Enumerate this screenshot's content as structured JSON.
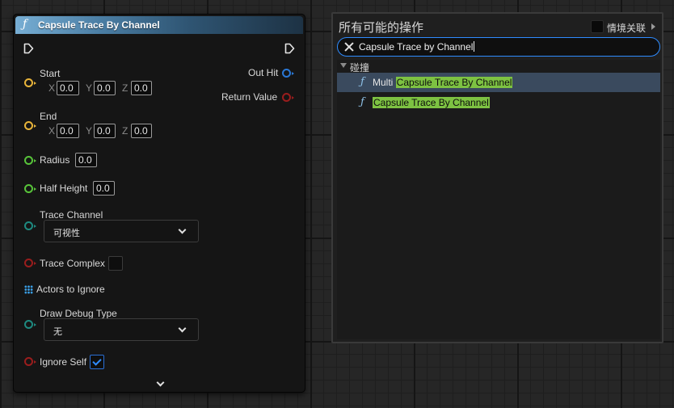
{
  "node": {
    "title": "Capsule Trace By Channel",
    "inputs": {
      "start": {
        "label": "Start",
        "x": "0.0",
        "y": "0.0",
        "z": "0.0"
      },
      "end": {
        "label": "End",
        "x": "0.0",
        "y": "0.0",
        "z": "0.0"
      },
      "radius": {
        "label": "Radius",
        "value": "0.0"
      },
      "half_height": {
        "label": "Half Height",
        "value": "0.0"
      },
      "trace_channel": {
        "label": "Trace Channel",
        "value": "可视性"
      },
      "trace_complex": {
        "label": "Trace Complex",
        "checked": false
      },
      "actors_to_ignore": {
        "label": "Actors to Ignore"
      },
      "draw_debug_type": {
        "label": "Draw Debug Type",
        "value": "无"
      },
      "ignore_self": {
        "label": "Ignore Self",
        "checked": true
      }
    },
    "axis_labels": {
      "x": "X",
      "y": "Y",
      "z": "Z"
    },
    "outputs": {
      "out_hit": "Out Hit",
      "return_value": "Return Value"
    }
  },
  "action_menu": {
    "title": "所有可能的操作",
    "context_label": "情境关联",
    "search_value": "Capsule Trace by Channel",
    "category": "碰撞",
    "results": [
      {
        "prefix": "Multi ",
        "match": "Capsule Trace By Channel",
        "selected": true
      },
      {
        "prefix": "",
        "match": "Capsule Trace By Channel",
        "selected": false
      }
    ]
  },
  "colors": {
    "vector_pin": "#e8b43a",
    "float_pin": "#58c43a",
    "enum_pin": "#1e8a80",
    "bool_pin": "#9a1d1d",
    "struct_pin": "#2a78d6",
    "highlight": "#7dc242",
    "accent": "#2f8cff"
  },
  "icons": {
    "function": "ƒ",
    "exec": "exec-pin-icon",
    "array": "array-grid-icon"
  }
}
